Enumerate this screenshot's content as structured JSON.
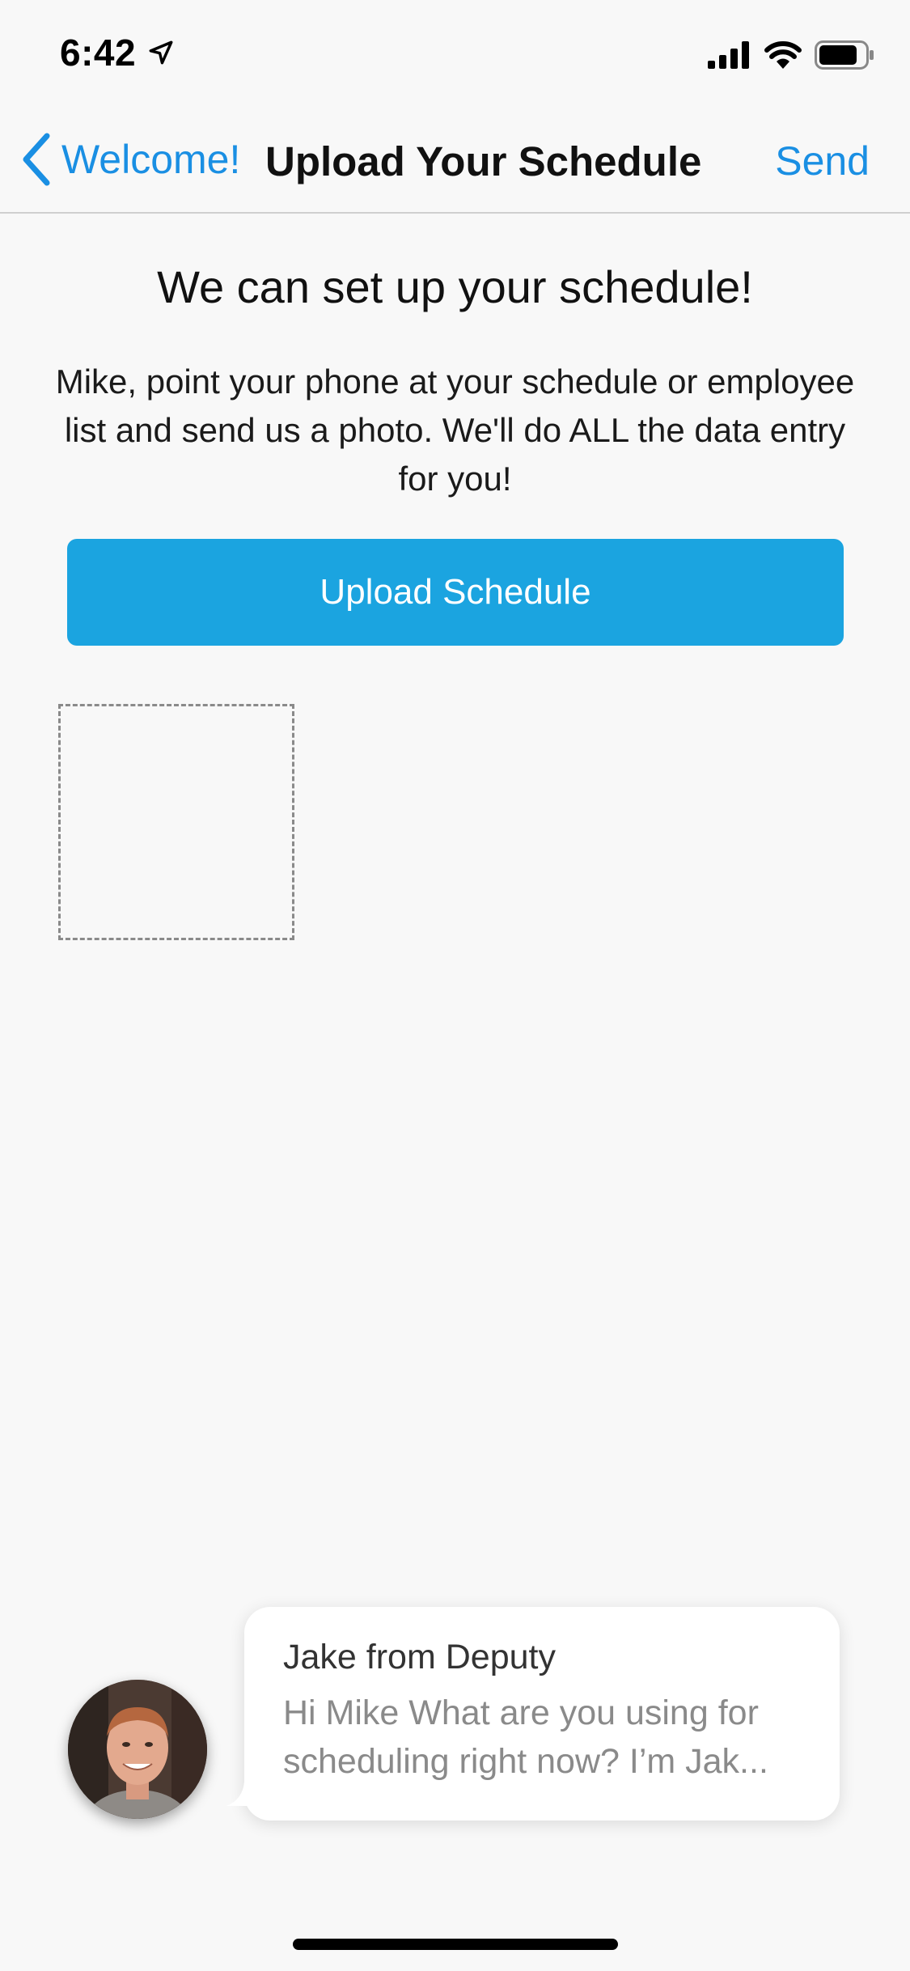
{
  "status_bar": {
    "time": "6:42",
    "icons": [
      "location-arrow-icon",
      "signal-icon",
      "wifi-icon",
      "battery-icon"
    ]
  },
  "nav": {
    "back_label": "Welcome!",
    "title": "Upload Your Schedule",
    "send_label": "Send",
    "accent_color": "#1a8fe3"
  },
  "content": {
    "heading": "We can set up your schedule!",
    "description": "Mike, point your phone at your schedule or employee list and send us a photo. We'll do ALL the data entry for you!",
    "upload_button_label": "Upload Schedule",
    "button_color": "#1ba4e0"
  },
  "chat": {
    "sender": "Jake from Deputy",
    "preview": "Hi Mike What are you using for scheduling right now? I’m Jak..."
  }
}
